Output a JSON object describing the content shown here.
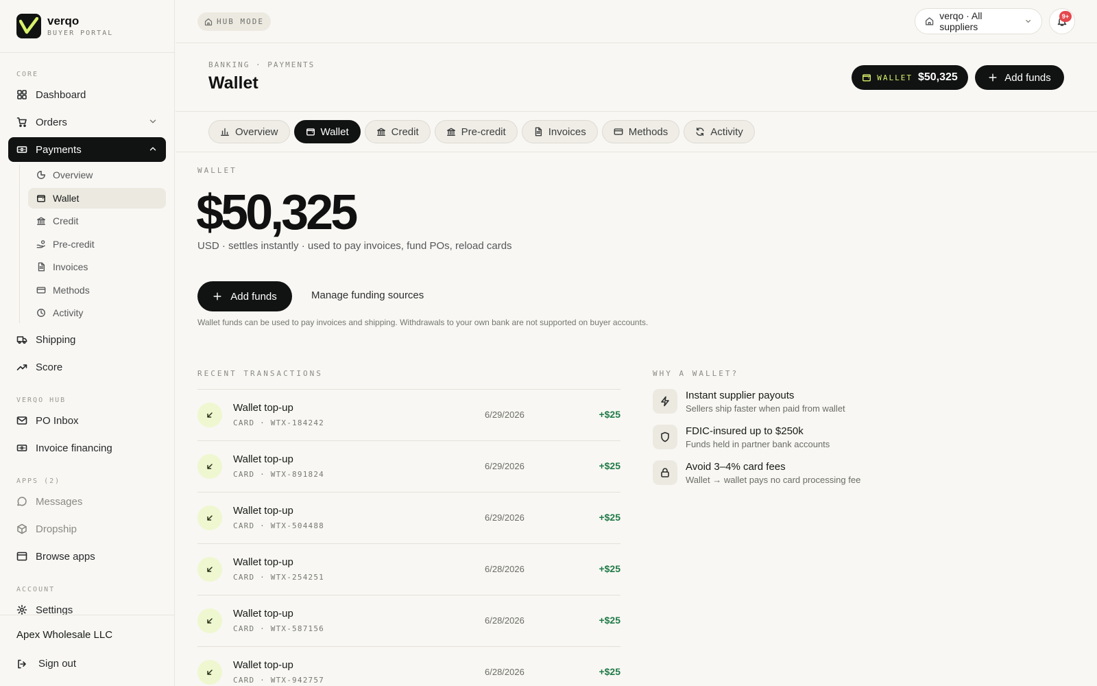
{
  "brand": {
    "name": "verqo",
    "subtitle": "BUYER PORTAL"
  },
  "colors": {
    "accent": "#d9f36b",
    "dark": "#111312",
    "positive": "#1f7a47",
    "badge": "#e5484d"
  },
  "sidebar": {
    "sections": {
      "core": "CORE",
      "hub": "VERQO HUB",
      "apps": "APPS (2)",
      "account": "ACCOUNT"
    },
    "items": {
      "dashboard": "Dashboard",
      "orders": "Orders",
      "payments": "Payments",
      "shipping": "Shipping",
      "score": "Score",
      "po_inbox": "PO Inbox",
      "invoice_financing": "Invoice financing",
      "messages": "Messages",
      "dropship": "Dropship",
      "browse_apps": "Browse apps",
      "settings": "Settings"
    },
    "payments_sub": {
      "overview": "Overview",
      "wallet": "Wallet",
      "credit": "Credit",
      "precredit": "Pre-credit",
      "invoices": "Invoices",
      "methods": "Methods",
      "activity": "Activity"
    },
    "company": "Apex Wholesale LLC",
    "signout": "Sign out"
  },
  "topbar": {
    "hub_mode": "HUB MODE",
    "supplier_select": "verqo · All suppliers",
    "notification_badge": "9+"
  },
  "header": {
    "breadcrumb": "BANKING · PAYMENTS",
    "title": "Wallet",
    "wallet_chip_label": "WALLET",
    "wallet_chip_value": "$50,325",
    "add_funds": "Add funds"
  },
  "tabs": {
    "overview": "Overview",
    "wallet": "Wallet",
    "credit": "Credit",
    "precredit": "Pre-credit",
    "invoices": "Invoices",
    "methods": "Methods",
    "activity": "Activity"
  },
  "wallet": {
    "eyebrow": "WALLET",
    "balance": "$50,325",
    "description": "USD · settles instantly · used to pay invoices, fund POs, reload cards",
    "add_funds": "Add funds",
    "manage": "Manage funding sources",
    "note": "Wallet funds can be used to pay invoices and shipping. Withdrawals to your own bank are not supported on buyer accounts."
  },
  "transactions": {
    "eyebrow": "RECENT TRANSACTIONS",
    "rows": [
      {
        "title": "Wallet top-up",
        "sub": "CARD · WTX-184242",
        "date": "6/29/2026",
        "amount": "+$25"
      },
      {
        "title": "Wallet top-up",
        "sub": "CARD · WTX-891824",
        "date": "6/29/2026",
        "amount": "+$25"
      },
      {
        "title": "Wallet top-up",
        "sub": "CARD · WTX-504488",
        "date": "6/29/2026",
        "amount": "+$25"
      },
      {
        "title": "Wallet top-up",
        "sub": "CARD · WTX-254251",
        "date": "6/28/2026",
        "amount": "+$25"
      },
      {
        "title": "Wallet top-up",
        "sub": "CARD · WTX-587156",
        "date": "6/28/2026",
        "amount": "+$25"
      },
      {
        "title": "Wallet top-up",
        "sub": "CARD · WTX-942757",
        "date": "6/28/2026",
        "amount": "+$25"
      }
    ]
  },
  "why": {
    "eyebrow": "WHY A WALLET?",
    "items": [
      {
        "icon": "lightning-icon",
        "title": "Instant supplier payouts",
        "desc": "Sellers ship faster when paid from wallet"
      },
      {
        "icon": "shield-icon",
        "title": "FDIC-insured up to $250k",
        "desc": "Funds held in partner bank accounts"
      },
      {
        "icon": "lock-icon",
        "title": "Avoid 3–4% card fees",
        "desc": "Wallet → wallet pays no card processing fee"
      }
    ]
  }
}
